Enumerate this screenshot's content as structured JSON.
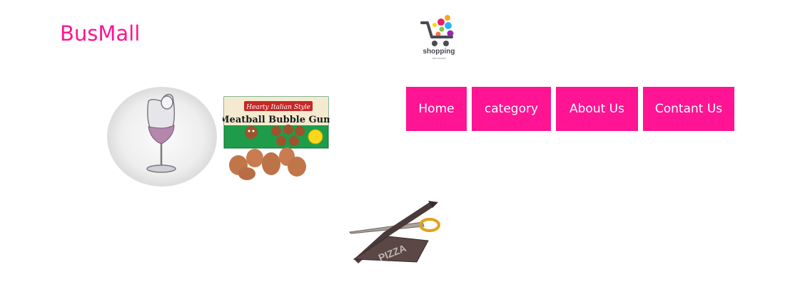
{
  "header": {
    "brand": "BusMall",
    "logo_text": "shopping",
    "logo_subtext": "cart concept"
  },
  "nav": {
    "items": [
      {
        "label": "Home"
      },
      {
        "label": "category"
      },
      {
        "label": "About Us"
      },
      {
        "label": "Contant Us"
      }
    ]
  },
  "products": {
    "gum_label_top": "Hearty Italian Style",
    "gum_label_main": "Meatball Bubble Gum",
    "scissors_label": "PIZZA"
  },
  "colors": {
    "accent": "#ff1493",
    "nav_text": "#ffffff"
  }
}
